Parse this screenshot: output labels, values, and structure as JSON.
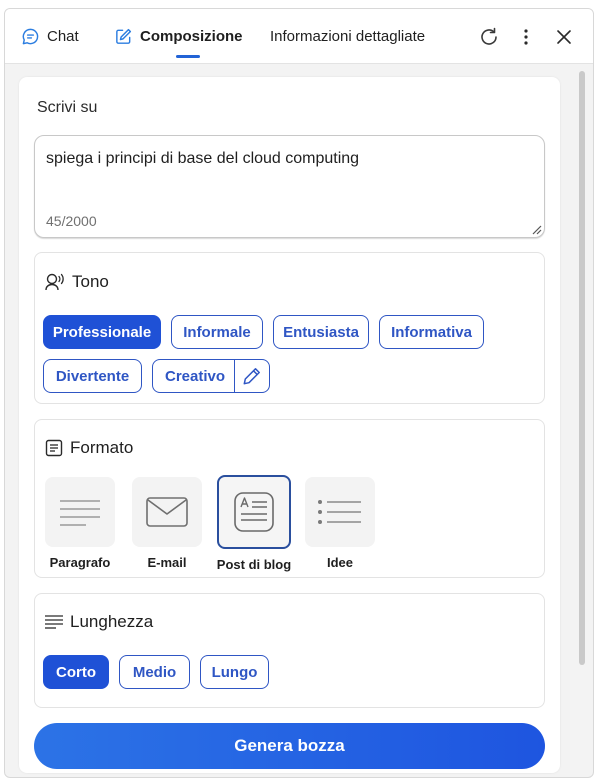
{
  "tabs": [
    {
      "label": "Chat",
      "icon": "chat-bubble-icon"
    },
    {
      "label": "Composizione",
      "icon": "compose-edit-icon",
      "active": true
    },
    {
      "label": "Informazioni dettagliate"
    }
  ],
  "compose": {
    "write_label": "Scrivi su",
    "prompt_text": "spiega i principi di base del cloud computing",
    "char_count": "45/2000"
  },
  "tone": {
    "title": "Tono",
    "options": [
      "Professionale",
      "Informale",
      "Entusiasta",
      "Informativa",
      "Divertente",
      "Creativo"
    ],
    "selected": "Professionale"
  },
  "format": {
    "title": "Formato",
    "options": [
      "Paragrafo",
      "E-mail",
      "Post di blog",
      "Idee"
    ],
    "selected": "Post di blog"
  },
  "length": {
    "title": "Lunghezza",
    "options": [
      "Corto",
      "Medio",
      "Lungo"
    ],
    "selected": "Corto"
  },
  "generate_label": "Genera bozza",
  "colors": {
    "accent": "#1f51d6",
    "chip_border": "#2f56c4",
    "button_gradient_start": "#2c73e6",
    "button_gradient_end": "#1e55e0"
  }
}
